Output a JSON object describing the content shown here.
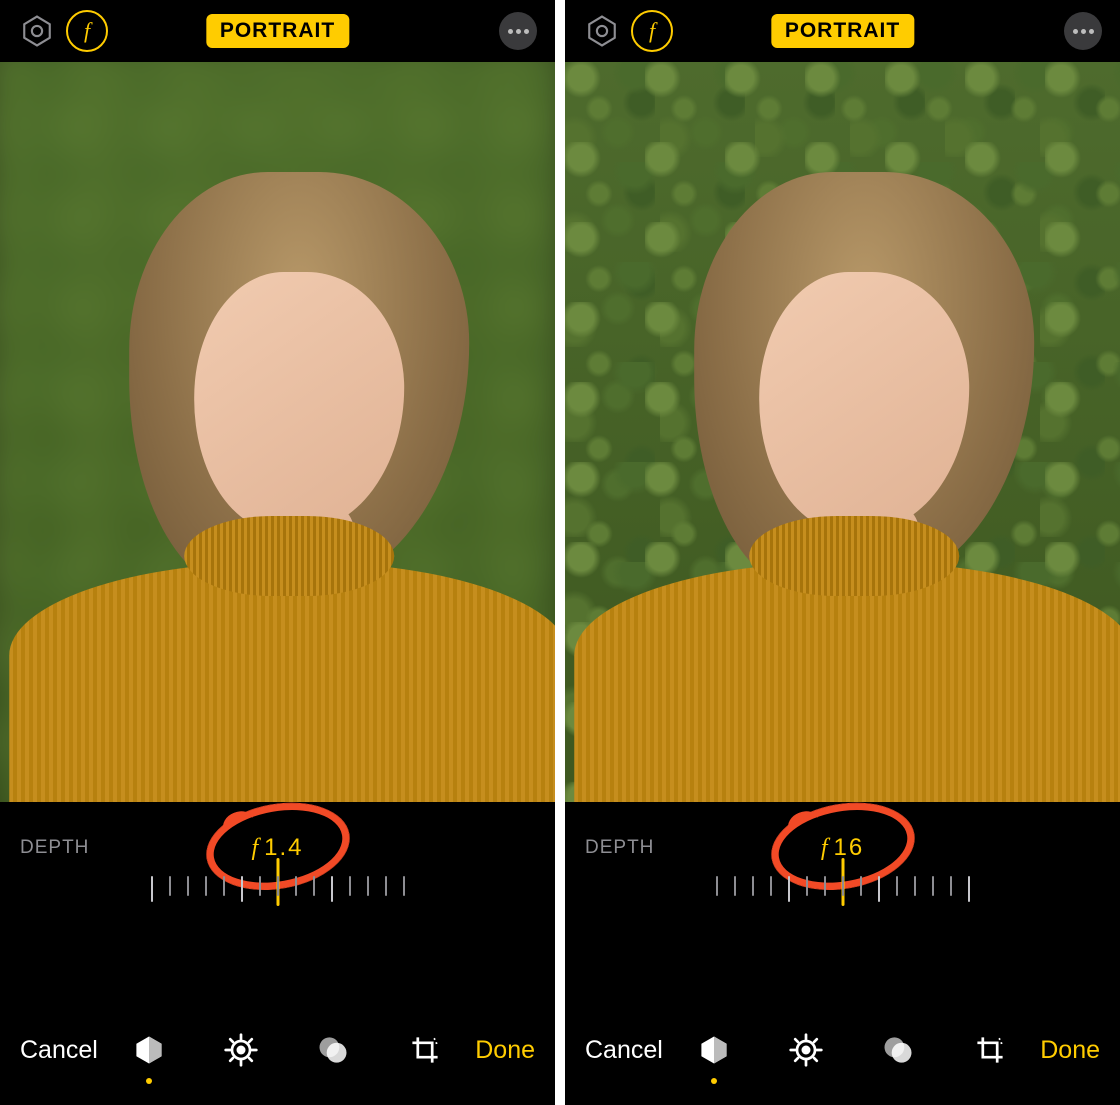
{
  "screens": [
    {
      "topbar": {
        "mode_label": "PORTRAIT",
        "f_icon_char": "f"
      },
      "photo": {
        "depth_effect": "shallow"
      },
      "depth": {
        "label": "DEPTH",
        "f_char": "f",
        "f_value": "1.4"
      },
      "bottombar": {
        "cancel": "Cancel",
        "done": "Done"
      },
      "annotation": {
        "type": "circle",
        "color": "#F24A26"
      }
    },
    {
      "topbar": {
        "mode_label": "PORTRAIT",
        "f_icon_char": "f"
      },
      "photo": {
        "depth_effect": "deep"
      },
      "depth": {
        "label": "DEPTH",
        "f_char": "f",
        "f_value": "16"
      },
      "bottombar": {
        "cancel": "Cancel",
        "done": "Done"
      },
      "annotation": {
        "type": "circle",
        "color": "#F24A26"
      }
    }
  ],
  "colors": {
    "accent": "#FFCC00",
    "annotate": "#F24A26"
  },
  "tools": [
    "portrait-lighting",
    "adjust",
    "filters",
    "crop"
  ],
  "active_tool_index": 0
}
